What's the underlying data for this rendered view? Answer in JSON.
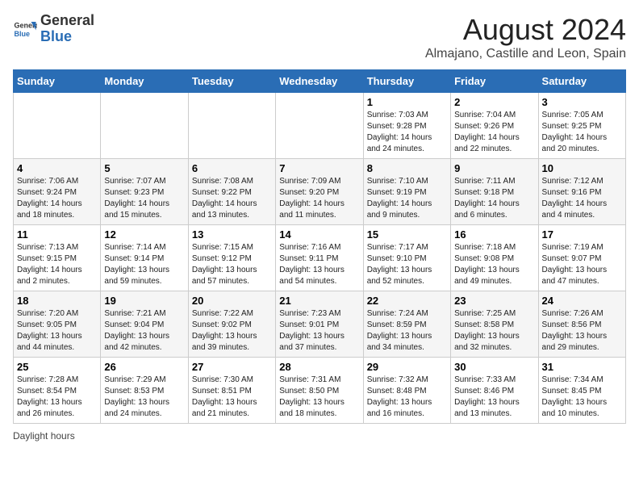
{
  "header": {
    "logo_general": "General",
    "logo_blue": "Blue",
    "main_title": "August 2024",
    "subtitle": "Almajano, Castille and Leon, Spain"
  },
  "calendar": {
    "weekdays": [
      "Sunday",
      "Monday",
      "Tuesday",
      "Wednesday",
      "Thursday",
      "Friday",
      "Saturday"
    ],
    "weeks": [
      [
        {
          "day": "",
          "info": ""
        },
        {
          "day": "",
          "info": ""
        },
        {
          "day": "",
          "info": ""
        },
        {
          "day": "",
          "info": ""
        },
        {
          "day": "1",
          "info": "Sunrise: 7:03 AM\nSunset: 9:28 PM\nDaylight: 14 hours and 24 minutes."
        },
        {
          "day": "2",
          "info": "Sunrise: 7:04 AM\nSunset: 9:26 PM\nDaylight: 14 hours and 22 minutes."
        },
        {
          "day": "3",
          "info": "Sunrise: 7:05 AM\nSunset: 9:25 PM\nDaylight: 14 hours and 20 minutes."
        }
      ],
      [
        {
          "day": "4",
          "info": "Sunrise: 7:06 AM\nSunset: 9:24 PM\nDaylight: 14 hours and 18 minutes."
        },
        {
          "day": "5",
          "info": "Sunrise: 7:07 AM\nSunset: 9:23 PM\nDaylight: 14 hours and 15 minutes."
        },
        {
          "day": "6",
          "info": "Sunrise: 7:08 AM\nSunset: 9:22 PM\nDaylight: 14 hours and 13 minutes."
        },
        {
          "day": "7",
          "info": "Sunrise: 7:09 AM\nSunset: 9:20 PM\nDaylight: 14 hours and 11 minutes."
        },
        {
          "day": "8",
          "info": "Sunrise: 7:10 AM\nSunset: 9:19 PM\nDaylight: 14 hours and 9 minutes."
        },
        {
          "day": "9",
          "info": "Sunrise: 7:11 AM\nSunset: 9:18 PM\nDaylight: 14 hours and 6 minutes."
        },
        {
          "day": "10",
          "info": "Sunrise: 7:12 AM\nSunset: 9:16 PM\nDaylight: 14 hours and 4 minutes."
        }
      ],
      [
        {
          "day": "11",
          "info": "Sunrise: 7:13 AM\nSunset: 9:15 PM\nDaylight: 14 hours and 2 minutes."
        },
        {
          "day": "12",
          "info": "Sunrise: 7:14 AM\nSunset: 9:14 PM\nDaylight: 13 hours and 59 minutes."
        },
        {
          "day": "13",
          "info": "Sunrise: 7:15 AM\nSunset: 9:12 PM\nDaylight: 13 hours and 57 minutes."
        },
        {
          "day": "14",
          "info": "Sunrise: 7:16 AM\nSunset: 9:11 PM\nDaylight: 13 hours and 54 minutes."
        },
        {
          "day": "15",
          "info": "Sunrise: 7:17 AM\nSunset: 9:10 PM\nDaylight: 13 hours and 52 minutes."
        },
        {
          "day": "16",
          "info": "Sunrise: 7:18 AM\nSunset: 9:08 PM\nDaylight: 13 hours and 49 minutes."
        },
        {
          "day": "17",
          "info": "Sunrise: 7:19 AM\nSunset: 9:07 PM\nDaylight: 13 hours and 47 minutes."
        }
      ],
      [
        {
          "day": "18",
          "info": "Sunrise: 7:20 AM\nSunset: 9:05 PM\nDaylight: 13 hours and 44 minutes."
        },
        {
          "day": "19",
          "info": "Sunrise: 7:21 AM\nSunset: 9:04 PM\nDaylight: 13 hours and 42 minutes."
        },
        {
          "day": "20",
          "info": "Sunrise: 7:22 AM\nSunset: 9:02 PM\nDaylight: 13 hours and 39 minutes."
        },
        {
          "day": "21",
          "info": "Sunrise: 7:23 AM\nSunset: 9:01 PM\nDaylight: 13 hours and 37 minutes."
        },
        {
          "day": "22",
          "info": "Sunrise: 7:24 AM\nSunset: 8:59 PM\nDaylight: 13 hours and 34 minutes."
        },
        {
          "day": "23",
          "info": "Sunrise: 7:25 AM\nSunset: 8:58 PM\nDaylight: 13 hours and 32 minutes."
        },
        {
          "day": "24",
          "info": "Sunrise: 7:26 AM\nSunset: 8:56 PM\nDaylight: 13 hours and 29 minutes."
        }
      ],
      [
        {
          "day": "25",
          "info": "Sunrise: 7:28 AM\nSunset: 8:54 PM\nDaylight: 13 hours and 26 minutes."
        },
        {
          "day": "26",
          "info": "Sunrise: 7:29 AM\nSunset: 8:53 PM\nDaylight: 13 hours and 24 minutes."
        },
        {
          "day": "27",
          "info": "Sunrise: 7:30 AM\nSunset: 8:51 PM\nDaylight: 13 hours and 21 minutes."
        },
        {
          "day": "28",
          "info": "Sunrise: 7:31 AM\nSunset: 8:50 PM\nDaylight: 13 hours and 18 minutes."
        },
        {
          "day": "29",
          "info": "Sunrise: 7:32 AM\nSunset: 8:48 PM\nDaylight: 13 hours and 16 minutes."
        },
        {
          "day": "30",
          "info": "Sunrise: 7:33 AM\nSunset: 8:46 PM\nDaylight: 13 hours and 13 minutes."
        },
        {
          "day": "31",
          "info": "Sunrise: 7:34 AM\nSunset: 8:45 PM\nDaylight: 13 hours and 10 minutes."
        }
      ]
    ]
  },
  "footer": {
    "note": "Daylight hours"
  }
}
